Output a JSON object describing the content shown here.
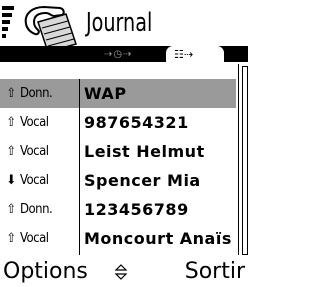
{
  "header": {
    "title": "Journal",
    "app_icon": "phone-handset-with-book-icon",
    "signal_icon": "signal-strength-icon",
    "antenna_icon": "antenna-icon"
  },
  "tabs": {
    "inactive_icon": "call-duration-timer-icon",
    "inactive_glyph": "⇢◷⇢",
    "active_icon": "log-list-icon",
    "active_glyph": "☷⇢"
  },
  "list": {
    "items": [
      {
        "type": "Donn.",
        "direction": "outgoing",
        "arrow": "⇧",
        "value": "WAP",
        "selected": true
      },
      {
        "type": "Vocal",
        "direction": "outgoing",
        "arrow": "⇧",
        "value": "987654321",
        "selected": false
      },
      {
        "type": "Vocal",
        "direction": "outgoing",
        "arrow": "⇧",
        "value": "Leist Helmut",
        "selected": false
      },
      {
        "type": "Vocal",
        "direction": "incoming",
        "arrow": "⬇",
        "value": "Spencer Mia",
        "selected": false
      },
      {
        "type": "Donn.",
        "direction": "outgoing",
        "arrow": "⇧",
        "value": "123456789",
        "selected": false
      },
      {
        "type": "Vocal",
        "direction": "outgoing",
        "arrow": "⇧",
        "value": "Moncourt Anaïs",
        "selected": false
      }
    ]
  },
  "softkeys": {
    "left": "Options",
    "right": "Sortir",
    "center_icon": "scroll-up-down-icon"
  },
  "colors": {
    "selection": "#9a9a9a",
    "inactive_tab": "#9a9a9a"
  }
}
